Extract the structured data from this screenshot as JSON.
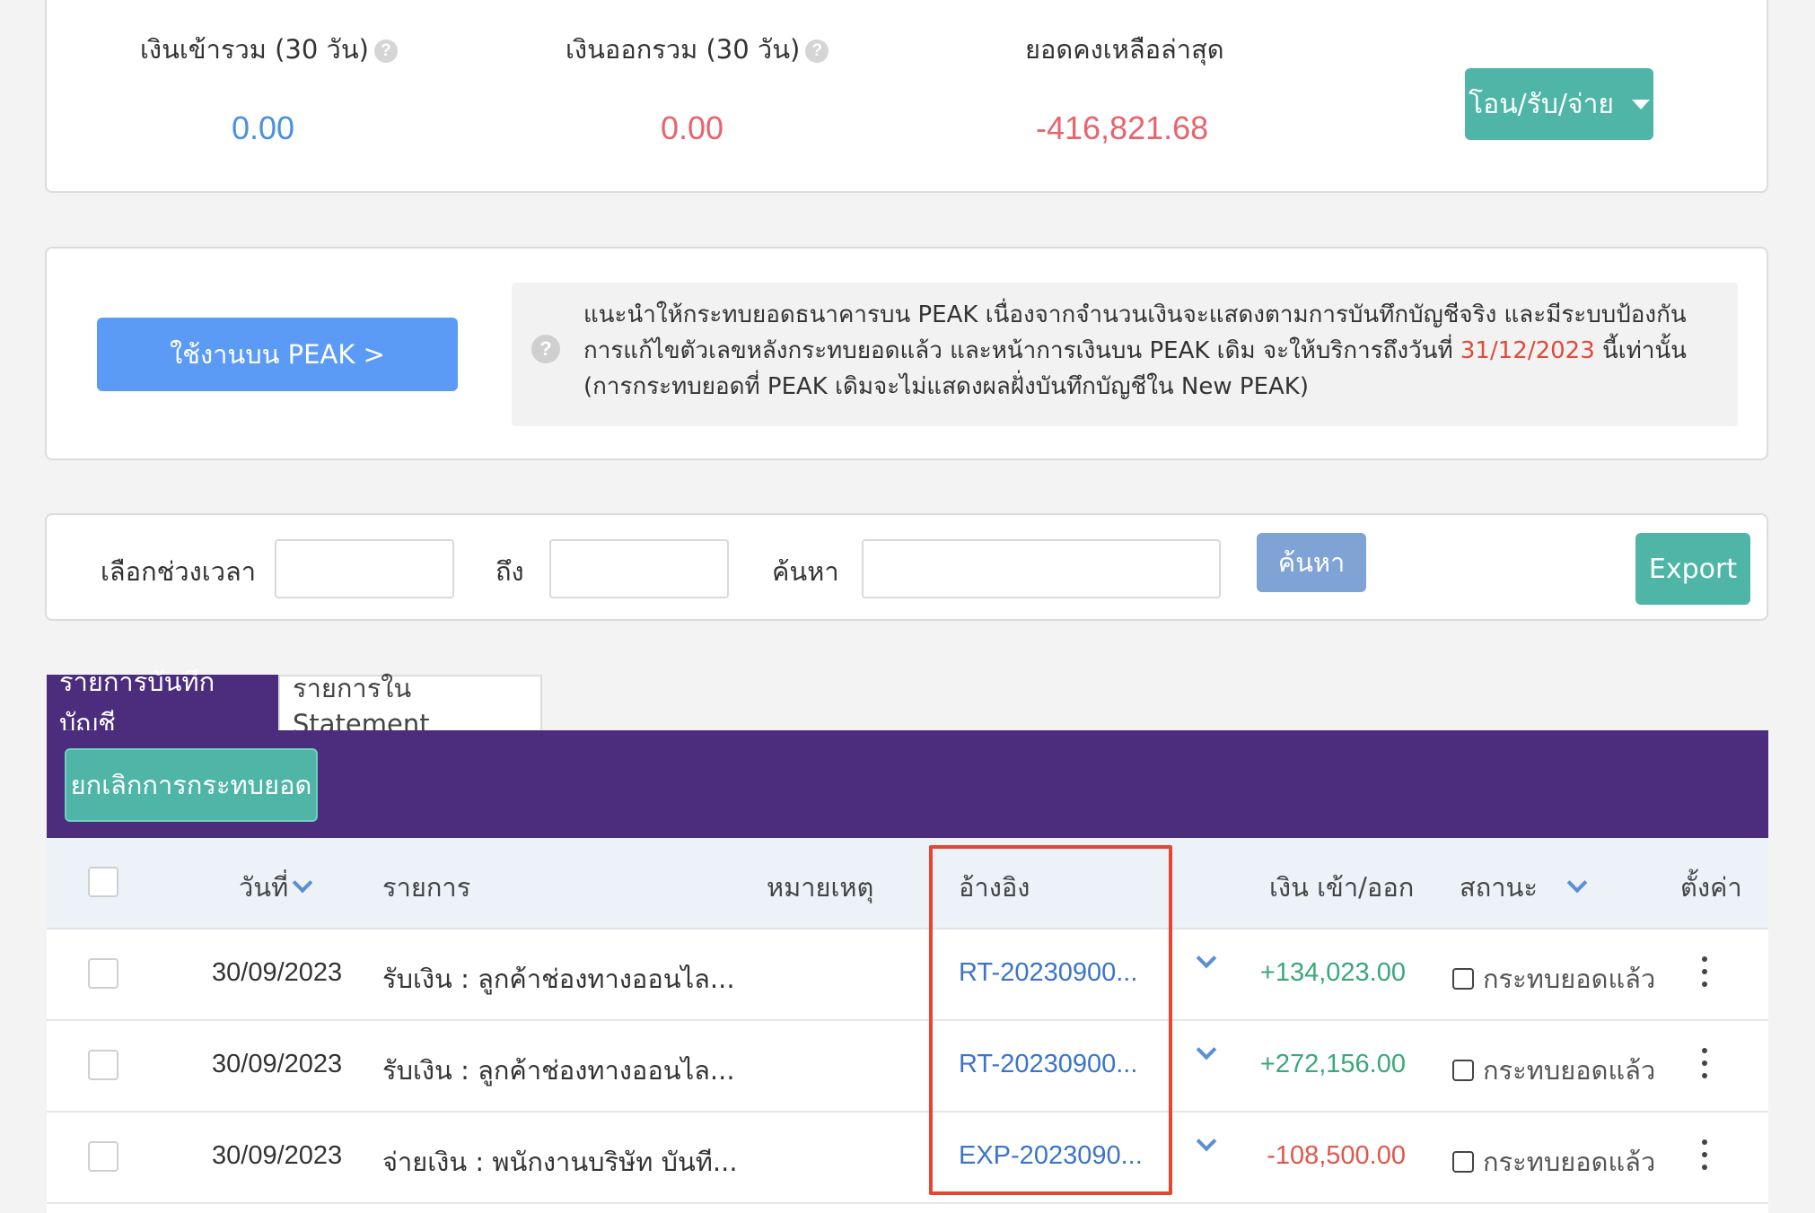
{
  "summary": {
    "income_label": "เงินเข้ารวม (30 วัน)",
    "income_value": "0.00",
    "expense_label": "เงินออกรวม (30 วัน)",
    "expense_value": "0.00",
    "balance_label": "ยอดคงเหลือล่าสุด",
    "balance_value": "-416,821.68",
    "transfer_button": "โอน/รับ/จ่าย",
    "help_glyph": "?"
  },
  "notice": {
    "peak_button": "ใช้งานบน PEAK >",
    "text_before": "แนะนำให้กระทบยอดธนาคารบน PEAK เนื่องจากจำนวนเงินจะแสดงตามการบันทึกบัญชีจริง และมีระบบป้องกันการแก้ไขตัวเลขหลังกระทบยอดแล้ว และหน้าการเงินบน PEAK เดิม จะให้บริการถึงวันที่ ",
    "date": "31/12/2023",
    "text_after": " นี้เท่านั้น (การกระทบยอดที่ PEAK เดิมจะไม่แสดงผลฝั่งบันทึกบัญชีใน New PEAK)"
  },
  "filter": {
    "period_label": "เลือกช่วงเวลา",
    "to_label": "ถึง",
    "search_label": "ค้นหา",
    "search_button": "ค้นหา",
    "export_button": "Export",
    "from_value": "",
    "to_value": "",
    "search_value": ""
  },
  "tabs": [
    {
      "label": "รายการบันทึกบัญชี",
      "active": true
    },
    {
      "label": "รายการใน Statement",
      "active": false
    }
  ],
  "toolbar": {
    "cancel_match_button": "ยกเลิกการกระทบยอด"
  },
  "table": {
    "columns": {
      "date": "วันที่",
      "item": "รายการ",
      "note": "หมายเหตุ",
      "reference": "อ้างอิง",
      "amount": "เงิน เข้า/ออก",
      "status": "สถานะ",
      "settings": "ตั้งค่า"
    },
    "rows": [
      {
        "date": "30/09/2023",
        "item": "รับเงิน : ลูกค้าช่องทางออนไล...",
        "reference": "RT-20230900...",
        "amount": "+134,023.00",
        "status": "กระทบยอดแล้ว"
      },
      {
        "date": "30/09/2023",
        "item": "รับเงิน : ลูกค้าช่องทางออนไล...",
        "reference": "RT-20230900...",
        "amount": "+272,156.00",
        "status": "กระทบยอดแล้ว"
      },
      {
        "date": "30/09/2023",
        "item": "จ่ายเงิน : พนักงานบริษัท บันที...",
        "reference": "EXP-2023090...",
        "amount": "-108,500.00",
        "status": "กระทบยอดแล้ว"
      }
    ]
  },
  "colors": {
    "income": "#4a90e2",
    "expense": "#e8646a",
    "teal": "#4eb5a7",
    "purple": "#4b2c7d",
    "highlight": "#e8442f"
  }
}
